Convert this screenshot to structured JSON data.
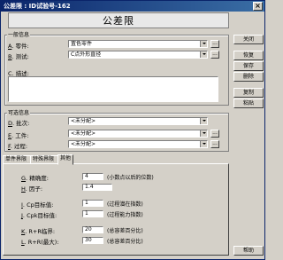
{
  "window": {
    "title": "公差限 : ID试验号-162",
    "close": "×"
  },
  "heading": "公差限",
  "general": {
    "label": "一般信息",
    "part_label": "零件:",
    "part_key": "A",
    "part_value": "置色零件",
    "test_label": "测试:",
    "test_key": "B",
    "test_value": "C点外形直径",
    "desc_label": "描述:",
    "desc_key": "C"
  },
  "optional": {
    "label": "可选信息",
    "batch_label": "批次:",
    "batch_key": "D",
    "batch_value": "<未分配>",
    "job_label": "工件:",
    "job_key": "E",
    "job_value": "<未分配>",
    "process_label": "过程:",
    "process_key": "F",
    "process_value": "<未分配>"
  },
  "buttons": {
    "close": "关闭",
    "restore": "恢复",
    "save": "保存",
    "delete": "删除",
    "copy": "复制",
    "paste": "粘贴",
    "help": "帮助"
  },
  "tabs": [
    "单件界限",
    "特殊界限",
    "其他"
  ],
  "other": {
    "precision_key": "G",
    "precision_label": "精确度:",
    "precision_value": "4",
    "precision_note": "(小数点以后的位数)",
    "factor_key": "H",
    "factor_label": "因子:",
    "factor_value": "1.4",
    "cp_key": "I",
    "cp_label": "Cp目标值:",
    "cp_value": "1",
    "cp_note": "(过程潜在指数)",
    "cpk_key": "J",
    "cpk_label": "Cpk目标值:",
    "cpk_value": "1",
    "cpk_note": "(过程能力指数)",
    "rr_key": "K",
    "rr_label": "R+R临界:",
    "rr_value": "20",
    "rr_note": "(总容差百分比)",
    "rrmax_key": "L",
    "rrmax_label": "R+R(最大):",
    "rrmax_value": "30",
    "rrmax_note": "(总容差百分比)"
  }
}
